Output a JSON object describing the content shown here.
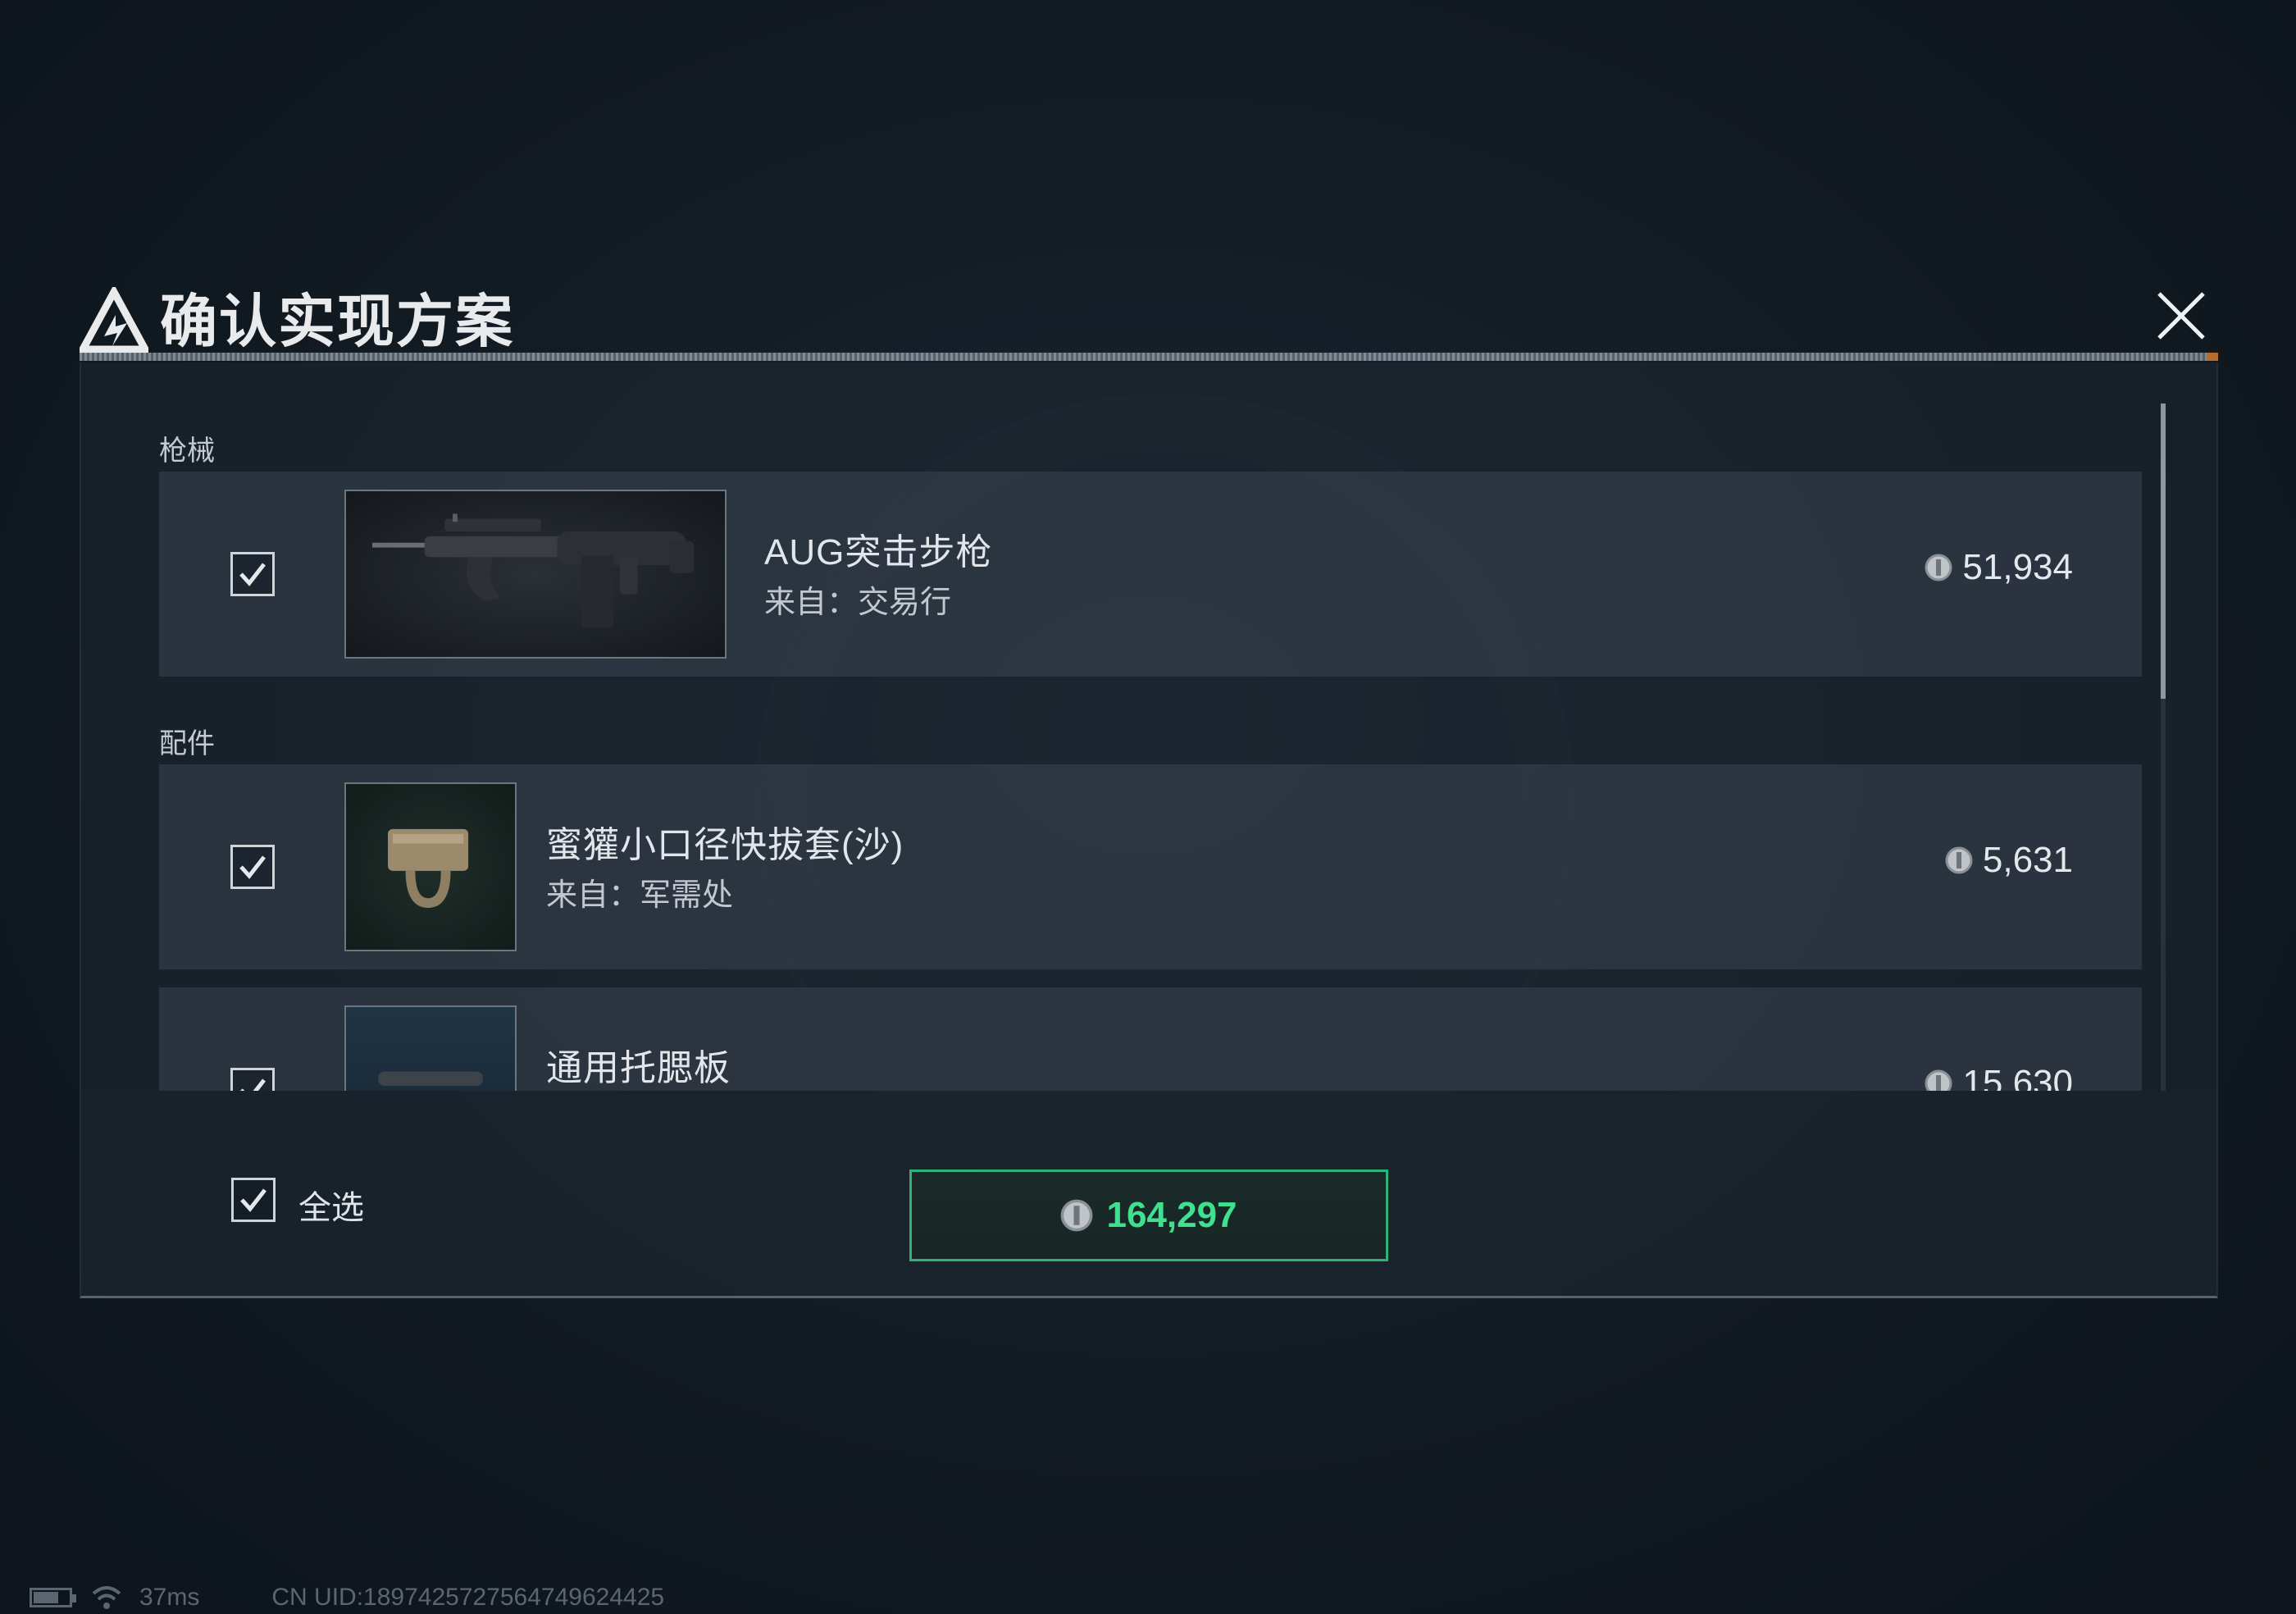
{
  "dialog": {
    "title": "确认实现方案",
    "close_icon": "close-icon"
  },
  "sections": {
    "guns_label": "枪械",
    "parts_label": "配件"
  },
  "items": [
    {
      "name": "AUG突击步枪",
      "source": "来自：交易行",
      "price": "51,934",
      "checked": true,
      "icon": "rifle-icon"
    },
    {
      "name": "蜜獾小口径快拔套(沙)",
      "source": "来自：军需处",
      "price": "5,631",
      "checked": true,
      "icon": "magazine-pouch-icon"
    },
    {
      "name": "通用托腮板",
      "source": "",
      "price": "15,630",
      "checked": true,
      "icon": "cheek-riser-icon"
    }
  ],
  "footer": {
    "select_all_label": "全选",
    "select_all_checked": true,
    "total": "164,297"
  },
  "status": {
    "ping": "37ms",
    "uid": "CN UID:1897425727564749624425"
  },
  "colors": {
    "accent_green": "#3fe08f",
    "button_border": "#2fb27a",
    "alert_orange": "#c8762c"
  }
}
